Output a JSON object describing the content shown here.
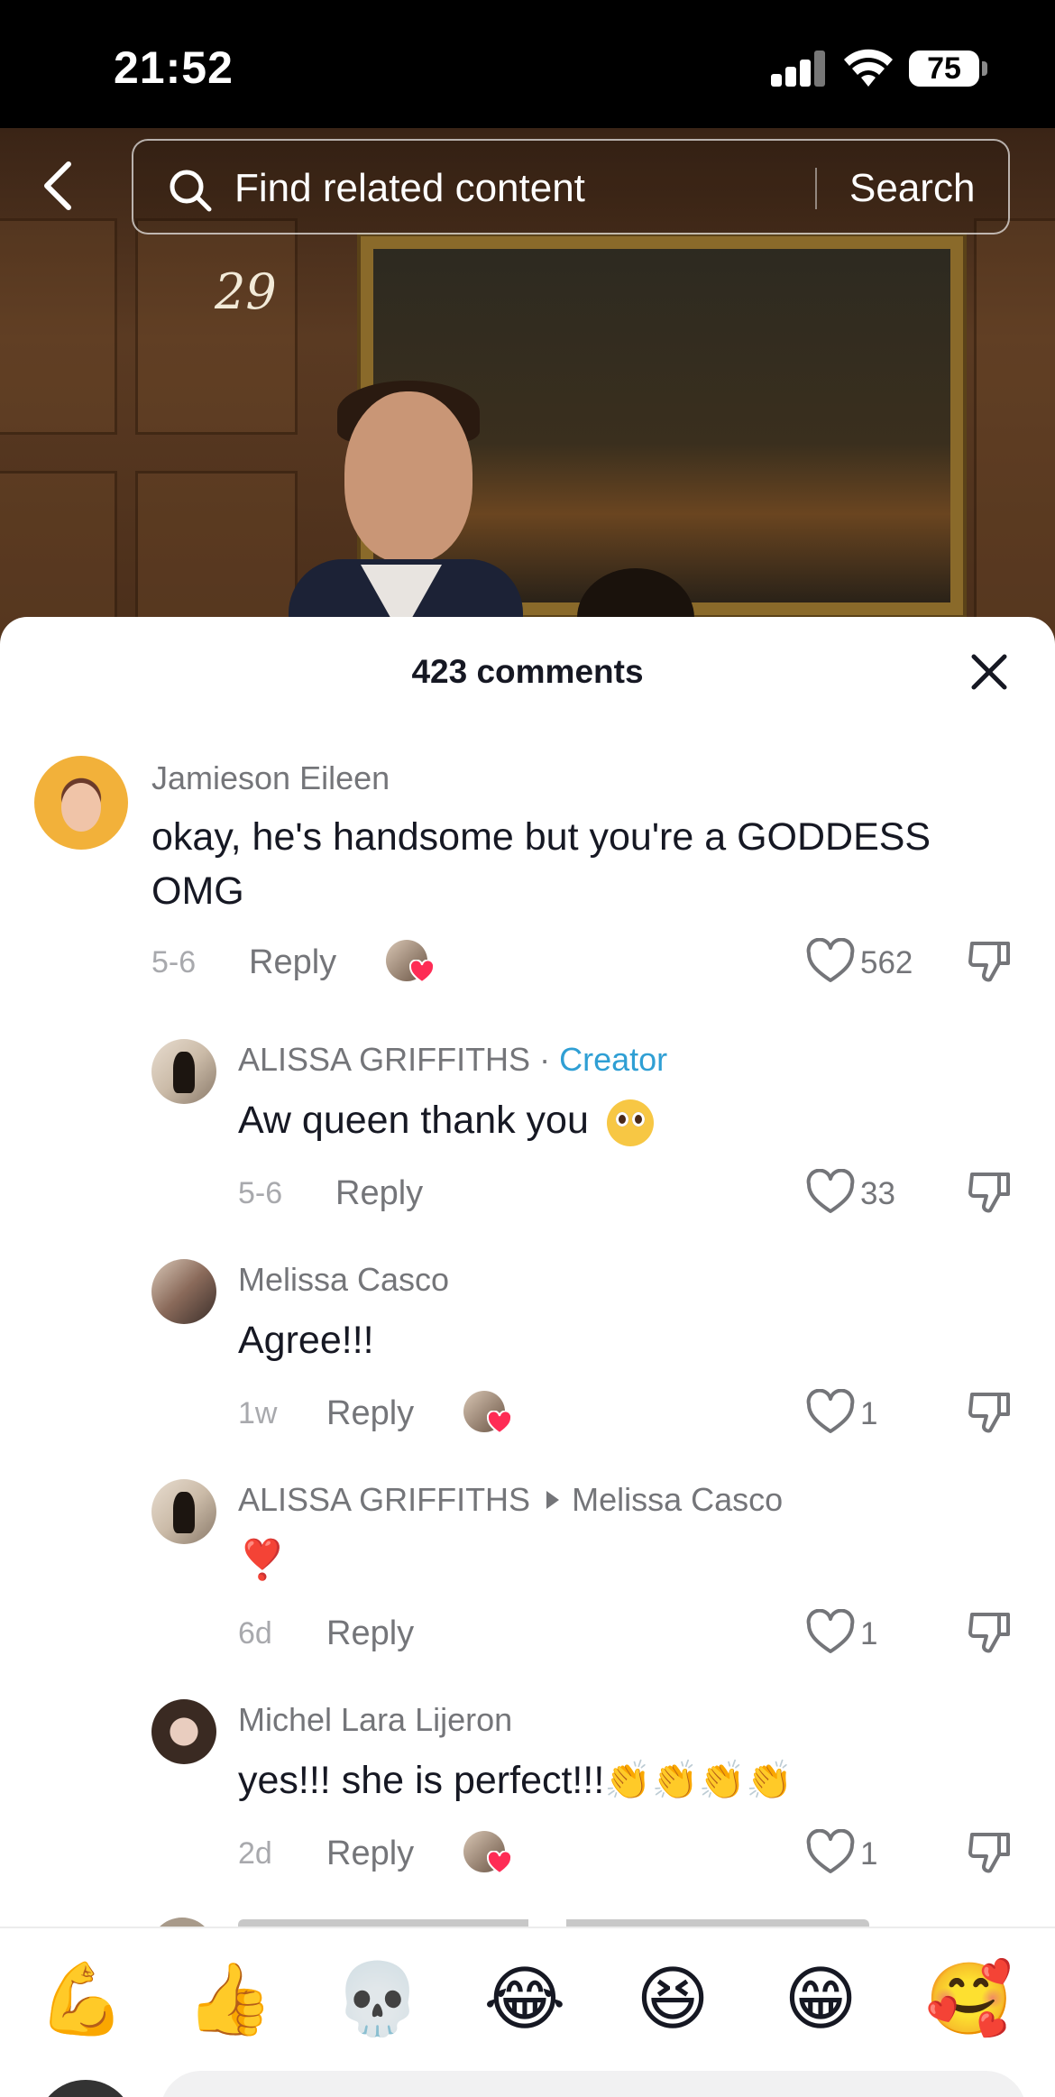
{
  "status_bar": {
    "time": "21:52",
    "battery": "75"
  },
  "video": {
    "overlay_number": "29"
  },
  "search": {
    "placeholder": "Find related content",
    "button_label": "Search"
  },
  "comments_sheet": {
    "title": "423 comments",
    "comments": [
      {
        "user": "Jamieson Eileen",
        "text_line1": "okay, he's handsome but you're a GODDESS",
        "text_line2": "OMG",
        "date": "5-6",
        "reply_label": "Reply",
        "likes": "562"
      },
      {
        "user": "ALISSA GRIFFITHS",
        "separator": "·",
        "badge": "Creator",
        "text": "Aw queen thank you",
        "date": "5-6",
        "reply_label": "Reply",
        "likes": "33"
      },
      {
        "user": "Melissa Casco",
        "text": "Agree!!!",
        "date": "1w",
        "reply_label": "Reply",
        "likes": "1"
      },
      {
        "user": "ALISSA GRIFFITHS",
        "reply_to": "Melissa Casco",
        "text": "❣️",
        "date": "6d",
        "reply_label": "Reply",
        "likes": "1"
      },
      {
        "user": "Michel Lara Lijeron",
        "text": "yes!!! she is perfect!!!",
        "text_emoji": "👏👏👏👏",
        "date": "2d",
        "reply_label": "Reply",
        "likes": "1"
      }
    ]
  },
  "emoji_bar": [
    "💪",
    "👍",
    "💀",
    "😂",
    "😆",
    "😁",
    "🥰"
  ],
  "icons": {
    "back": "chevron-left-icon",
    "search": "magnifier-icon",
    "close": "close-icon",
    "like": "heart-outline-icon",
    "dislike": "thumbs-down-icon",
    "creator_like": "heart-filled-icon"
  },
  "colors": {
    "creator_badge": "#2f9fd4",
    "heart_red": "#fe2c55",
    "secondary_text": "#747579"
  }
}
